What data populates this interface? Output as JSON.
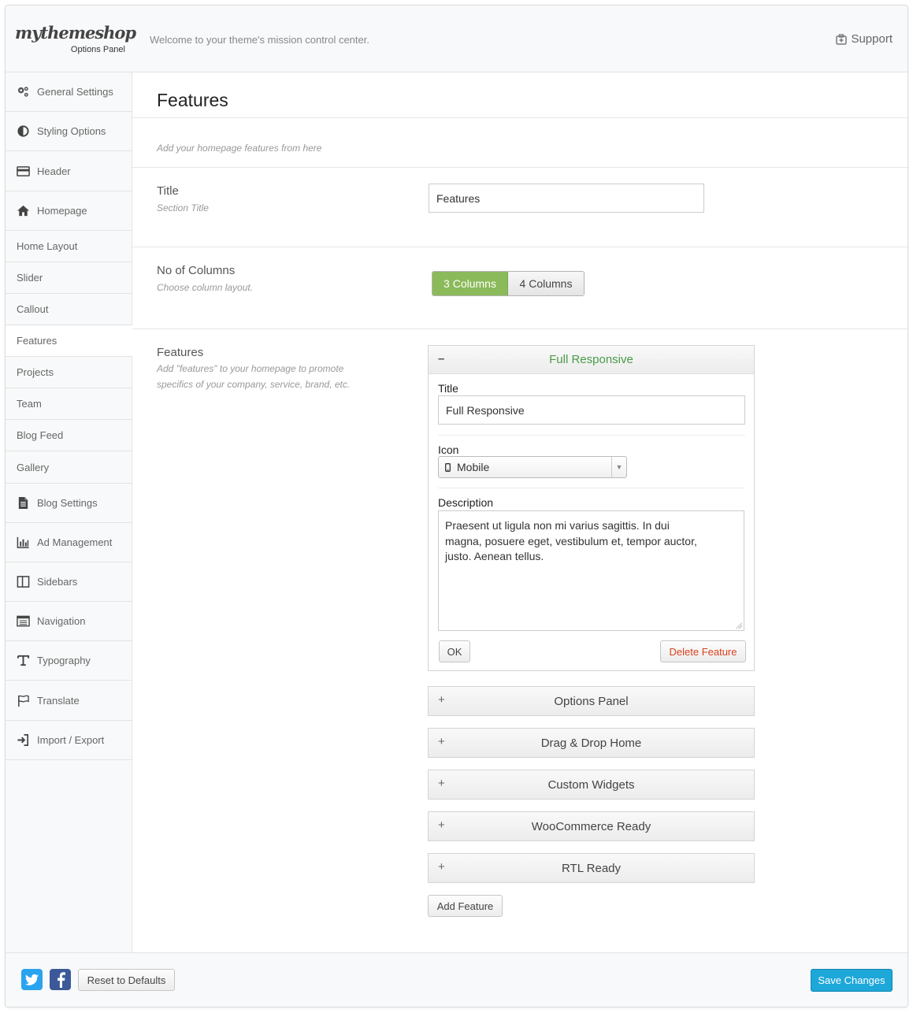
{
  "header": {
    "logo_text": "mythemeshop",
    "logo_sub": "Options Panel",
    "tagline": "Welcome to your theme's mission control center.",
    "support_label": "Support"
  },
  "sidebar": {
    "items": [
      {
        "label": "General Settings",
        "icon": "gears-icon"
      },
      {
        "label": "Styling Options",
        "icon": "contrast-icon"
      },
      {
        "label": "Header",
        "icon": "card-icon"
      },
      {
        "label": "Homepage",
        "icon": "home-icon"
      },
      {
        "label": "Home Layout"
      },
      {
        "label": "Slider"
      },
      {
        "label": "Callout"
      },
      {
        "label": "Features",
        "active": true
      },
      {
        "label": "Projects"
      },
      {
        "label": "Team"
      },
      {
        "label": "Blog Feed"
      },
      {
        "label": "Gallery"
      },
      {
        "label": "Blog Settings",
        "icon": "document-icon"
      },
      {
        "label": "Ad Management",
        "icon": "bar-chart-icon"
      },
      {
        "label": "Sidebars",
        "icon": "columns-icon"
      },
      {
        "label": "Navigation",
        "icon": "list-icon"
      },
      {
        "label": "Typography",
        "icon": "text-icon"
      },
      {
        "label": "Translate",
        "icon": "flag-icon"
      },
      {
        "label": "Import / Export",
        "icon": "sign-in-icon"
      }
    ]
  },
  "main": {
    "title": "Features",
    "description": "Add your homepage features from here",
    "title_field": {
      "label": "Title",
      "help": "Section Title",
      "value": "Features"
    },
    "columns_field": {
      "label": "No of Columns",
      "help": "Choose column layout.",
      "options": [
        "3 Columns",
        "4 Columns"
      ],
      "selected": "3 Columns"
    },
    "features_field": {
      "label": "Features",
      "help": "Add \"features\" to your homepage to promote specifics of your company, service, brand, etc."
    },
    "open_feature": {
      "header": "Full Responsive",
      "collapse_sign": "–",
      "title_label": "Title",
      "title_value": "Full Responsive",
      "icon_label": "Icon",
      "icon_value": "Mobile",
      "description_label": "Description",
      "description_value": "Praesent ut ligula non mi varius sagittis. In dui magna, posuere eget, vestibulum et, tempor auctor, justo. Aenean tellus.",
      "ok_label": "OK",
      "delete_label": "Delete Feature"
    },
    "collapsed_features": [
      {
        "title": "Options Panel",
        "sign": "+"
      },
      {
        "title": "Drag & Drop Home",
        "sign": "+"
      },
      {
        "title": "Custom Widgets",
        "sign": "+"
      },
      {
        "title": "WooCommerce Ready",
        "sign": "+"
      },
      {
        "title": "RTL Ready",
        "sign": "+"
      }
    ],
    "add_feature_label": "Add Feature"
  },
  "footer": {
    "reset_label": "Reset to Defaults",
    "save_label": "Save Changes"
  },
  "colors": {
    "accent_blue": "#1ea7d9",
    "selected_green": "#8bba5a",
    "open_title_green": "#4a9b4a",
    "delete_red": "#d9411e",
    "twitter": "#2aa3ef",
    "facebook": "#3b5998"
  }
}
